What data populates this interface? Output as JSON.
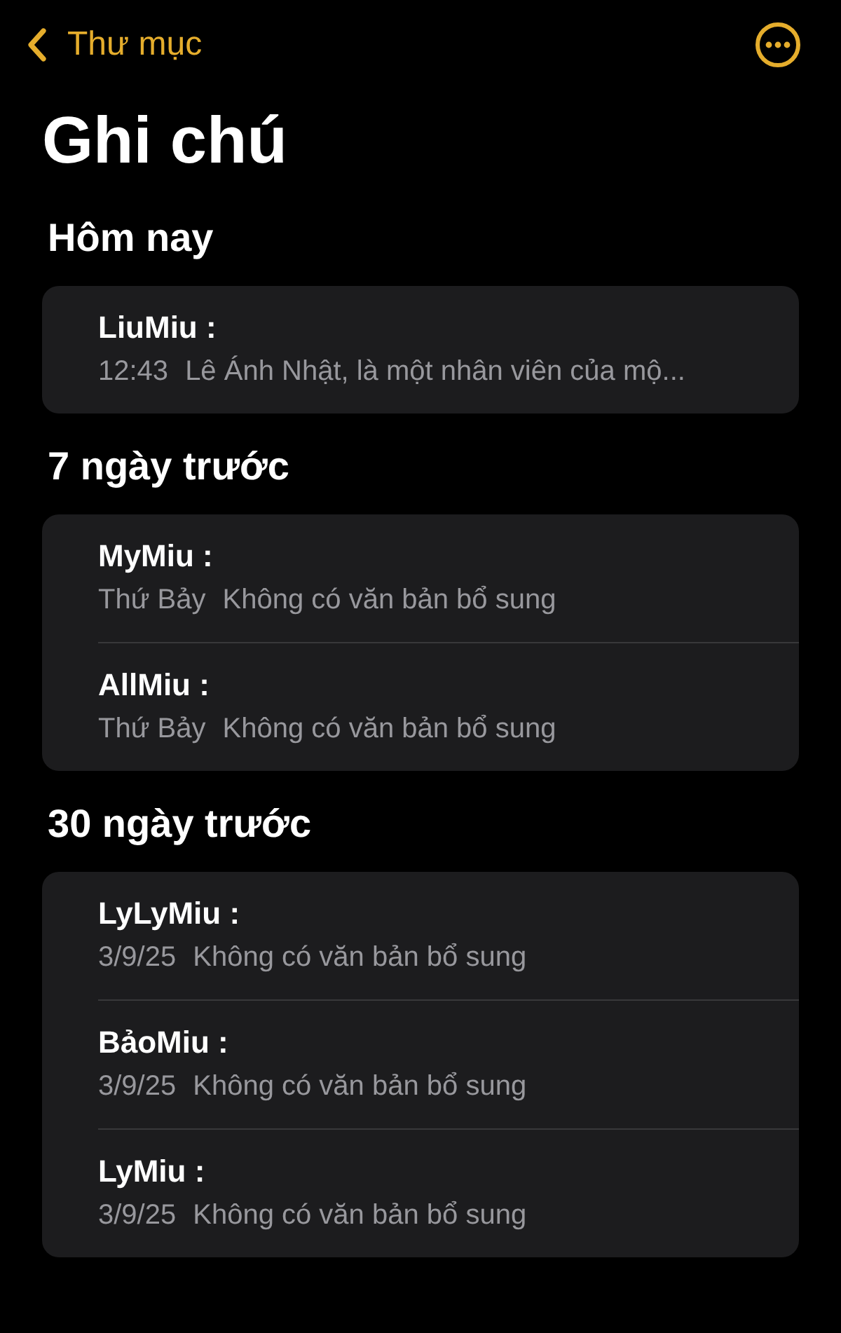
{
  "nav": {
    "back_label": "Thư mục"
  },
  "title": "Ghi chú",
  "sections": [
    {
      "heading": "Hôm nay",
      "notes": [
        {
          "title": "LiuMiu :",
          "date": "12:43",
          "preview": "Lê Ánh Nhật, là một nhân viên của mộ..."
        }
      ]
    },
    {
      "heading": "7 ngày trước",
      "notes": [
        {
          "title": "MyMiu :",
          "date": "Thứ Bảy",
          "preview": "Không có văn bản bổ sung"
        },
        {
          "title": "AllMiu :",
          "date": "Thứ Bảy",
          "preview": "Không có văn bản bổ sung"
        }
      ]
    },
    {
      "heading": "30 ngày trước",
      "notes": [
        {
          "title": "LyLyMiu :",
          "date": "3/9/25",
          "preview": "Không có văn bản bổ sung"
        },
        {
          "title": "BảoMiu :",
          "date": "3/9/25",
          "preview": "Không có văn bản bổ sung"
        },
        {
          "title": "LyMiu :",
          "date": "3/9/25",
          "preview": "Không có văn bản bổ sung"
        }
      ]
    }
  ]
}
